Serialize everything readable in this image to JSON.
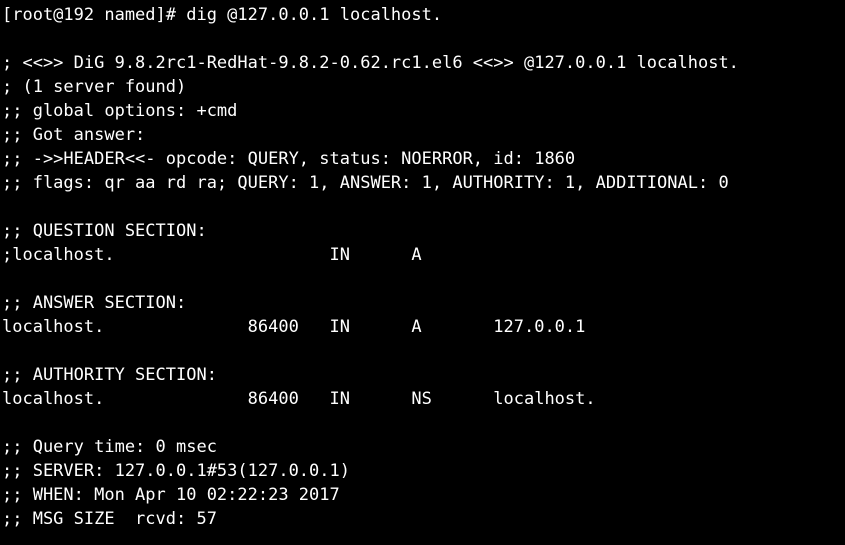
{
  "terminal": {
    "lines": [
      "[root@192 named]# dig @127.0.0.1 localhost.",
      "",
      "; <<>> DiG 9.8.2rc1-RedHat-9.8.2-0.62.rc1.el6 <<>> @127.0.0.1 localhost.",
      "; (1 server found)",
      ";; global options: +cmd",
      ";; Got answer:",
      ";; ->>HEADER<<- opcode: QUERY, status: NOERROR, id: 1860",
      ";; flags: qr aa rd ra; QUERY: 1, ANSWER: 1, AUTHORITY: 1, ADDITIONAL: 0",
      "",
      ";; QUESTION SECTION:",
      ";localhost.                     IN      A",
      "",
      ";; ANSWER SECTION:",
      "localhost.              86400   IN      A       127.0.0.1",
      "",
      ";; AUTHORITY SECTION:",
      "localhost.              86400   IN      NS      localhost.",
      "",
      ";; Query time: 0 msec",
      ";; SERVER: 127.0.0.1#53(127.0.0.1)",
      ";; WHEN: Mon Apr 10 02:22:23 2017",
      ";; MSG SIZE  rcvd: 57"
    ]
  }
}
